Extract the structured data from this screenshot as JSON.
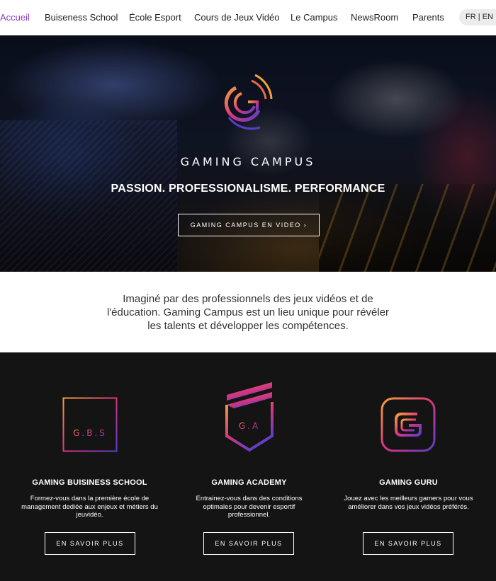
{
  "nav": {
    "items": [
      {
        "label": "Accueil",
        "active": true
      },
      {
        "label": "Buiseness School"
      },
      {
        "label": "École Esport"
      },
      {
        "label": "Cours de Jeux Vidéo"
      },
      {
        "label": "Le Campus"
      },
      {
        "label": "NewsRoom"
      },
      {
        "label": "Parents"
      }
    ],
    "language": "FR | EN"
  },
  "hero": {
    "logo_icon": "gaming-campus-logo-icon",
    "brand": "GAMING CAMPUS",
    "tagline": "PASSION. PROFESSIONALISME. PERFORMANCE",
    "cta": "GAMING CAMPUS EN VIDEO ›"
  },
  "intro": {
    "text": "Imaginé par des professionnels des jeux vidéos et de l'éducation. Gaming Campus est un lieu unique pour révéler les talents et développer les compétences."
  },
  "schools": [
    {
      "icon": "gbs-logo-icon",
      "icon_text": "G.B.S",
      "title": "GAMING BUISINESS SCHOOL",
      "description": "Formez-vous dans la première école de management dediée aux enjeux et métiers du jeuvidéo.",
      "cta": "EN SAVOIR PLUS"
    },
    {
      "icon": "ga-shield-icon",
      "icon_text": "G.A",
      "title": "GAMING ACADEMY",
      "description": "Entrainez-vous dans des conditions optimales pour devenir esportif professionnel.",
      "cta": "EN SAVOIR PLUS"
    },
    {
      "icon": "gaming-guru-icon",
      "title": "GAMING GURU",
      "description": "Jouez avec les meilleurs gamers pour vous améliorer dans vos jeux vidéos préférés.",
      "cta": "EN SAVOIR PLUS"
    }
  ],
  "colors": {
    "accent": "#8b3fc8",
    "gradient_start": "#f5a03c",
    "gradient_mid": "#d8357e",
    "gradient_end": "#5b3ec8",
    "dark_bg": "#141414"
  }
}
